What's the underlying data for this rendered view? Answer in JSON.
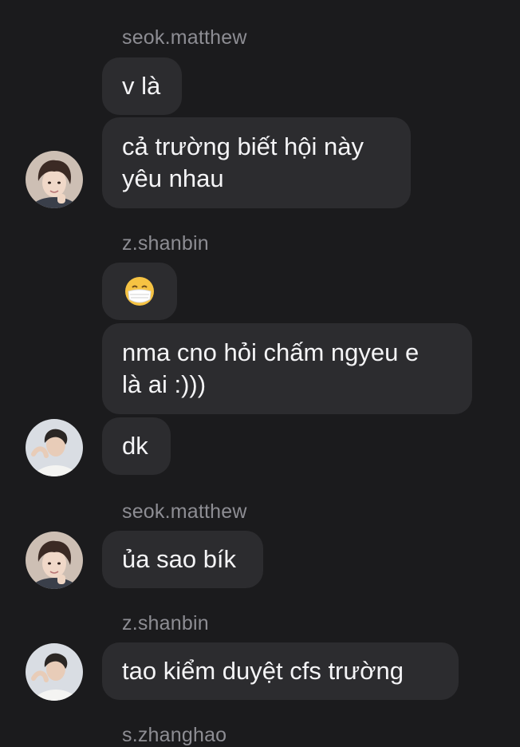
{
  "messages": [
    {
      "sender": "seok.matthew",
      "text": "v là"
    },
    {
      "line1": "cả trường biết hội này",
      "line2": "yêu nhau"
    },
    {
      "sender": "z.shanbin",
      "emoji": "face-with-medical-mask"
    },
    {
      "line1": "nma cno hỏi chấm ngyeu e",
      "line2": "là ai :)))"
    },
    {
      "text": "dk"
    },
    {
      "sender": "seok.matthew",
      "text": "ủa sao bík"
    },
    {
      "sender": "z.shanbin",
      "text": "tao kiểm duyệt cfs trường"
    },
    {
      "sender": "s.zhanghao"
    }
  ],
  "avatars": {
    "seok_matthew": "avatar-seok-matthew",
    "z_shanbin": "avatar-z-shanbin"
  },
  "colors": {
    "background": "#1b1b1d",
    "bubble": "#2c2c2f",
    "sender_text": "#8d8d93",
    "message_text": "#f4f4f6"
  }
}
